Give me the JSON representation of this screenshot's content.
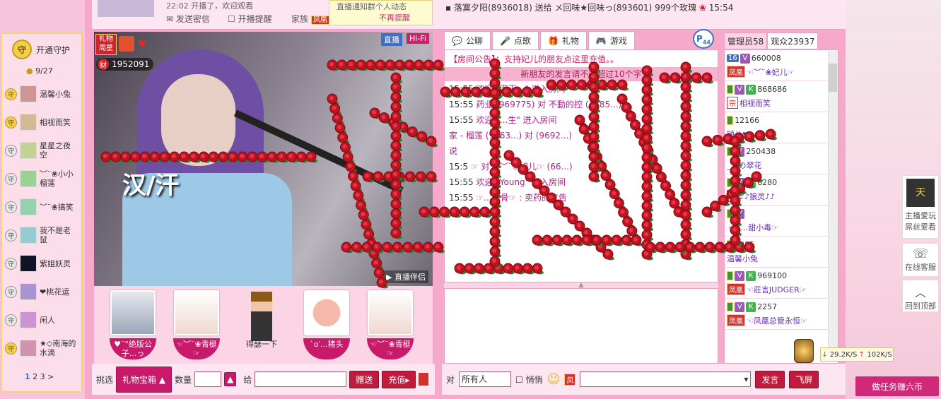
{
  "top": {
    "line1": "22:02 开播了，欢迎观看",
    "send_msg": "发送密信",
    "live_alert": "开播提醒",
    "family_label": "家族",
    "family_badge": "凤凰",
    "popup_line1": "直播通知群个人动态",
    "popup_action": "不再提醒",
    "ticker": "▪ 落寞夕阳(8936018) 送给 メ回味★回味っ(893601) 999个玫瑰",
    "ticker_time": "15:54"
  },
  "guard": {
    "title": "开通守护",
    "count": "9/27",
    "items": [
      {
        "name": "温馨小兔",
        "badge": "守",
        "gold": true
      },
      {
        "name": "相视而笑",
        "badge": "守",
        "gold": true
      },
      {
        "name": "星星之夜空",
        "badge": "守",
        "gold": false
      },
      {
        "name": "︶¨❀小小榴莲",
        "badge": "守",
        "gold": false
      },
      {
        "name": "︶¨❀搞笑",
        "badge": "守",
        "gold": false
      },
      {
        "name": "我不是老鼠",
        "badge": "守",
        "gold": false
      },
      {
        "name": "紫姐妖灵",
        "badge": "守",
        "gold": false
      },
      {
        "name": "❤桃花运",
        "badge": "守",
        "gold": false
      },
      {
        "name": "闲人",
        "badge": "守",
        "gold": false
      },
      {
        "name": "★◇南海的水滴",
        "badge": "守",
        "gold": true
      }
    ],
    "pages": [
      "1",
      "2",
      "3"
    ],
    "next": ">"
  },
  "video": {
    "badge": "礼物周星",
    "wealth_icon": "财",
    "wealth_value": "1952091",
    "live": "直播",
    "hifi": "Hi-Fi",
    "overlay_text": "汉/汗",
    "brand": "直播伴侣"
  },
  "gift_avatars": [
    {
      "label": "♥¨°绝版公子...っ"
    },
    {
      "label": "☜︶¨❀青梃☞"
    },
    {
      "label": "得瑟一下"
    },
    {
      "label": "`o′...猪头"
    },
    {
      "label": "☜︶¨❀青梃☞"
    }
  ],
  "gift_controls": {
    "pick": "挑选",
    "box": "礼物宝箱",
    "qty_label": "数量",
    "to_label": "给",
    "gift_btn": "赠送",
    "recharge_btn": "充值",
    "recharge_arrow": "▸"
  },
  "chat": {
    "tabs": [
      "公聊",
      "点歌",
      "礼物",
      "游戏"
    ],
    "p_badge": "P",
    "p_count": "44",
    "announce_label": "【房间公告】：",
    "announce_text": "支持妃儿的朋友点这里充值。。",
    "warning": "新朋友的发言请不要超过10个字",
    "lines": [
      {
        "t": "15:55",
        "text": "欢迎 \"海天...\" 进入房间"
      },
      {
        "t": "15:55",
        "text": "药业 (969775) 对 不動的控 (1885...)"
      },
      {
        "t": "15:55",
        "text": "欢迎 \"...生\" 进入房间"
      },
      {
        "t": "",
        "text": "家 - 榴莲 (9663...) 对 (9692...)"
      },
      {
        "t": "",
        "text": "说"
      },
      {
        "t": "15:5",
        "text": "☞ 对 ☜︶¨❀妃儿☞ (66...)"
      },
      {
        "t": "15:55",
        "text": "欢迎 \"Young\" 进入房间"
      },
      {
        "t": "15:55",
        "text": "☞...排骨☞ : 卖药的广告"
      }
    ]
  },
  "send": {
    "to_label": "对",
    "to_value": "所有人",
    "whisper": "悄悄",
    "say_btn": "发言",
    "fly_btn": "飞屏"
  },
  "users": {
    "tab_admin": "管理员58",
    "tab_viewers": "观众23937",
    "rows": [
      {
        "lv": "16",
        "badges": [
          "V"
        ],
        "id": "660008",
        "rank": "凤凰",
        "name": "☜︶¨❀妃儿☞"
      },
      {
        "lv": "",
        "badges": [
          "V",
          "K"
        ],
        "id": "868686",
        "rank": "宗",
        "name": "相视而笑"
      },
      {
        "lv": "",
        "badges": [],
        "id": "12166",
        "rank": "",
        "name": "穎儿❤"
      },
      {
        "lv": "",
        "badges": [
          "V"
        ],
        "id": "250438",
        "rank": "",
        "name": "___の翠花"
      },
      {
        "lv": "",
        "badges": [
          "V",
          "K"
        ],
        "id": "8280",
        "rank": "宗",
        "name": "♪♪狼灵♪♪"
      },
      {
        "lv": "",
        "badges": [
          "V"
        ],
        "id": "",
        "rank": "",
        "name": "☜★...甜小毒☞"
      },
      {
        "lv": "",
        "badges": [],
        "id": "9285",
        "rank": "",
        "name": "温馨小兔"
      },
      {
        "lv": "",
        "badges": [
          "V",
          "K"
        ],
        "id": "969100",
        "rank": "凤凰",
        "name": "☜莊言JUDGER☞"
      },
      {
        "lv": "",
        "badges": [
          "V",
          "K"
        ],
        "id": "2257",
        "rank": "凤凰",
        "name": "☜凤凰总管永恒☞"
      }
    ]
  },
  "side": {
    "fans_label": "主播爱玩屌丝爱看",
    "service_label": "在线客服",
    "top_label": "回到顶部",
    "down_speed": "29.2K/S",
    "up_speed": "102K/S",
    "task_btn": "做任务赚六币"
  },
  "colors": {
    "accent": "#c8196a",
    "frame": "#f7a9cc",
    "rose": "#c1121f"
  }
}
